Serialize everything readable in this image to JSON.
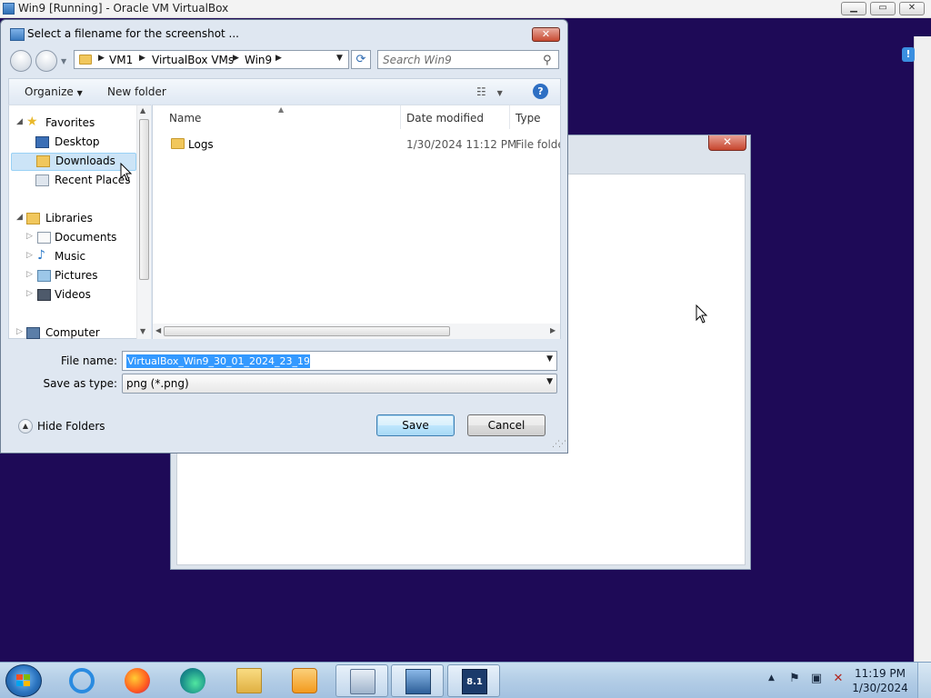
{
  "host": {
    "title": "Win9 [Running] - Oracle VM VirtualBox",
    "buttons": {
      "minimize": "▁",
      "restore": "▭",
      "close": "✕"
    }
  },
  "background_window": {
    "close": "✕"
  },
  "dialog": {
    "title": "Select a filename for the screenshot ...",
    "close": "✕",
    "breadcrumbs": [
      "VM1",
      "VirtualBox VMs",
      "Win9"
    ],
    "search_placeholder": "Search Win9",
    "toolbar": {
      "organize": "Organize",
      "new_folder": "New folder",
      "help": "?"
    },
    "nav": {
      "favorites": "Favorites",
      "desktop": "Desktop",
      "downloads": "Downloads",
      "recent_places": "Recent Places",
      "libraries": "Libraries",
      "documents": "Documents",
      "music": "Music",
      "pictures": "Pictures",
      "videos": "Videos",
      "computer": "Computer"
    },
    "columns": {
      "name": "Name",
      "date_modified": "Date modified",
      "type": "Type"
    },
    "files": [
      {
        "name": "Logs",
        "date_modified": "1/30/2024 11:12 PM",
        "type": "File folder"
      }
    ],
    "file_name_label": "File name:",
    "file_name_value": "VirtualBox_Win9_30_01_2024_23_19_47",
    "save_as_type_label": "Save as type:",
    "save_as_type_value": "png (*.png)",
    "hide_folders": "Hide Folders",
    "save_button": "Save",
    "cancel_button": "Cancel"
  },
  "taskbar": {
    "apps": [
      "internet-explorer",
      "firefox",
      "edge",
      "file-explorer",
      "media-player",
      "keyboard-settings",
      "virtualbox",
      "windows-8-1"
    ],
    "clock_time": "11:19 PM",
    "clock_date": "1/30/2024"
  },
  "colors": {
    "desktop_bg": "#1e0a57",
    "selection": "#3399ff",
    "dialog_frame": "#dfe7f1"
  }
}
